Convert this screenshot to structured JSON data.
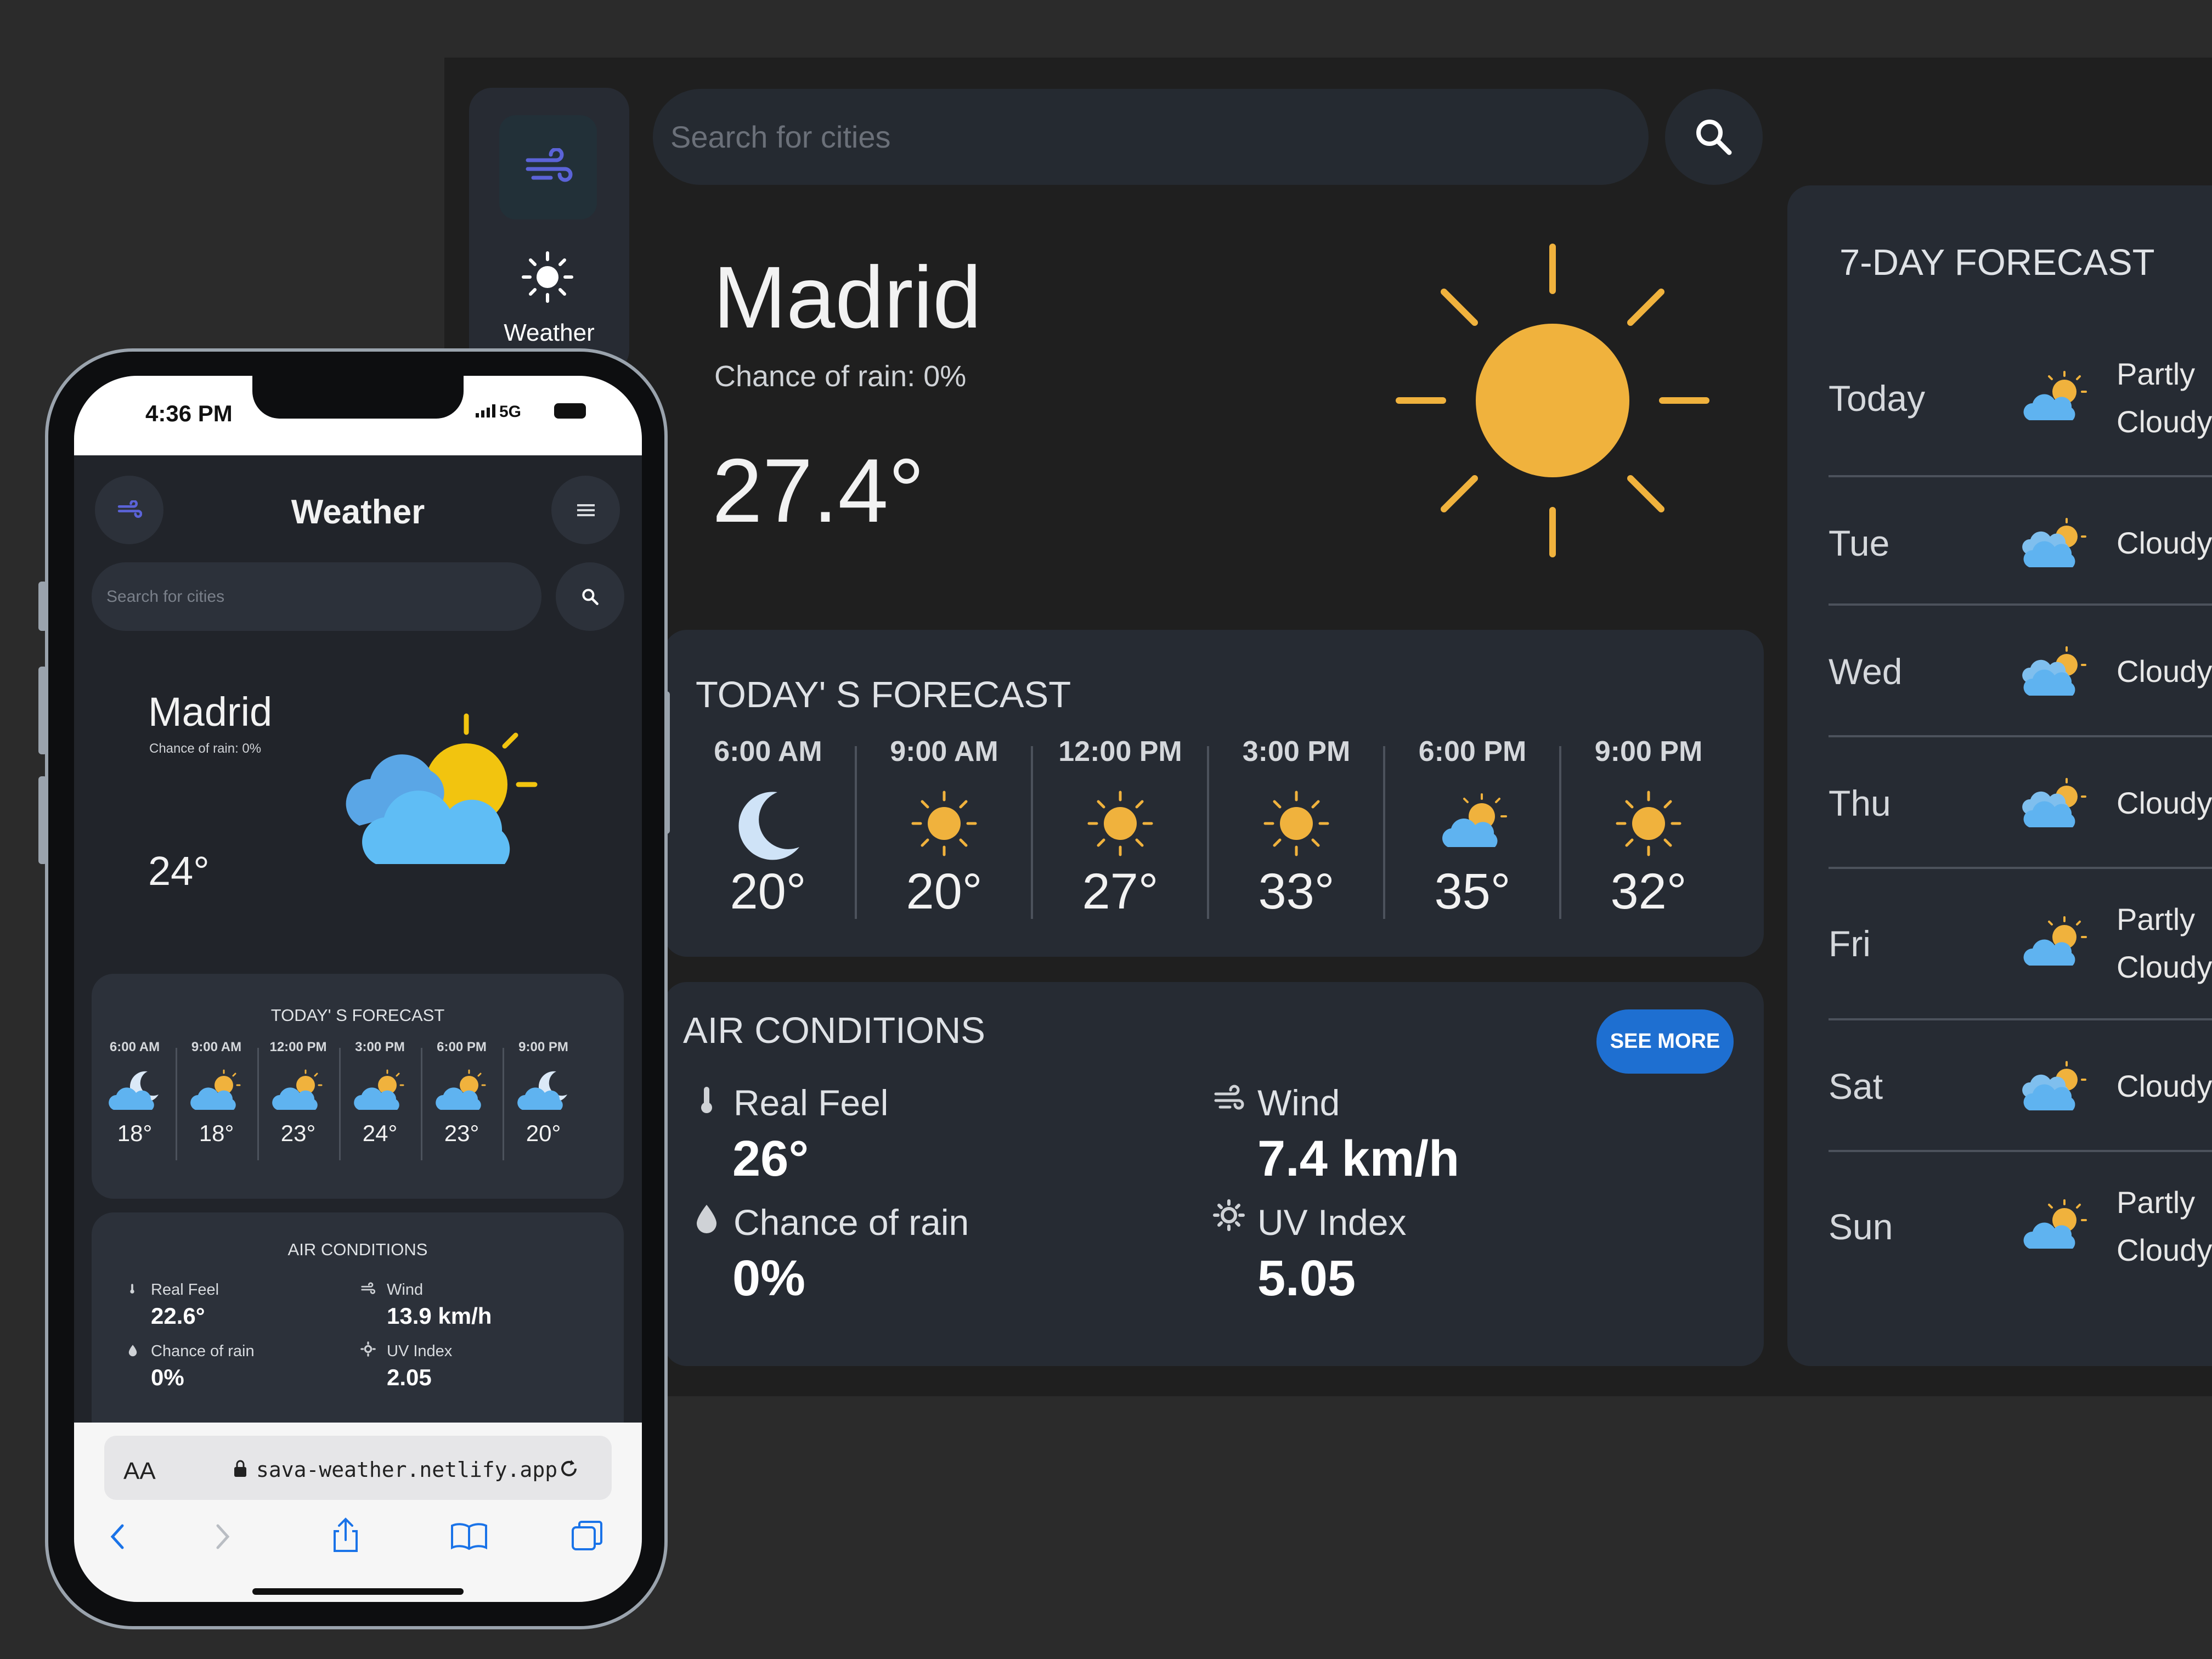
{
  "desktop": {
    "rail": {
      "label": "Weather"
    },
    "search": {
      "placeholder": "Search for cities"
    },
    "current": {
      "city": "Madrid",
      "rain": "Chance of rain: 0%",
      "temp": "27.4°"
    },
    "today": {
      "title": "TODAY' S FORECAST",
      "hours": [
        {
          "time": "6:00 AM",
          "icon": "moon-icon",
          "temp": "20°"
        },
        {
          "time": "9:00 AM",
          "icon": "sun-icon",
          "temp": "20°"
        },
        {
          "time": "12:00 PM",
          "icon": "sun-icon",
          "temp": "27°"
        },
        {
          "time": "3:00 PM",
          "icon": "sun-icon",
          "temp": "33°"
        },
        {
          "time": "6:00 PM",
          "icon": "partly-cloudy-icon",
          "temp": "35°"
        },
        {
          "time": "9:00 PM",
          "icon": "sun-icon",
          "temp": "32°"
        }
      ]
    },
    "air": {
      "title": "AIR CONDITIONS",
      "see_more": "SEE MORE",
      "items": [
        {
          "label": "Real Feel",
          "value": "26°",
          "icon": "thermometer-icon"
        },
        {
          "label": "Wind",
          "value": "7.4 km/h",
          "icon": "wind-icon"
        },
        {
          "label": "Chance of rain",
          "value": "0%",
          "icon": "drop-icon"
        },
        {
          "label": "UV Index",
          "value": "5.05",
          "icon": "uv-icon"
        }
      ]
    },
    "week": {
      "title": "7-DAY FORECAST",
      "days": [
        {
          "day": "Today",
          "cond1": "Partly",
          "cond2": "Cloudy"
        },
        {
          "day": "Tue",
          "cond1": "Cloudy",
          "cond2": ""
        },
        {
          "day": "Wed",
          "cond1": "Cloudy",
          "cond2": ""
        },
        {
          "day": "Thu",
          "cond1": "Cloudy",
          "cond2": ""
        },
        {
          "day": "Fri",
          "cond1": "Partly",
          "cond2": "Cloudy"
        },
        {
          "day": "Sat",
          "cond1": "Cloudy",
          "cond2": ""
        },
        {
          "day": "Sun",
          "cond1": "Partly",
          "cond2": "Cloudy"
        }
      ]
    }
  },
  "phone": {
    "status": {
      "time": "4:36 PM",
      "network": "5G"
    },
    "header": {
      "title": "Weather"
    },
    "search": {
      "placeholder": "Search for cities"
    },
    "current": {
      "city": "Madrid",
      "rain": "Chance of rain: 0%",
      "temp": "24°"
    },
    "today": {
      "title": "TODAY' S FORECAST",
      "hours": [
        {
          "time": "6:00 AM",
          "icon": "cloud-moon-icon",
          "temp": "18°"
        },
        {
          "time": "9:00 AM",
          "icon": "partly-cloudy-icon",
          "temp": "18°"
        },
        {
          "time": "12:00 PM",
          "icon": "partly-cloudy-icon",
          "temp": "23°"
        },
        {
          "time": "3:00 PM",
          "icon": "partly-cloudy-icon",
          "temp": "24°"
        },
        {
          "time": "6:00 PM",
          "icon": "partly-cloudy-icon",
          "temp": "23°"
        },
        {
          "time": "9:00 PM",
          "icon": "cloud-moon-icon",
          "temp": "20°"
        }
      ]
    },
    "air": {
      "title": "AIR CONDITIONS",
      "items": [
        {
          "label": "Real Feel",
          "value": "22.6°"
        },
        {
          "label": "Wind",
          "value": "13.9 km/h"
        },
        {
          "label": "Chance of rain",
          "value": "0%"
        },
        {
          "label": "UV Index",
          "value": "2.05"
        }
      ]
    },
    "browser": {
      "aa": "AA",
      "url": "sava-weather.netlify.app"
    }
  },
  "colors": {
    "sun": "#f0b23d",
    "cloud": "#5fb3f0",
    "accent": "#1e6fd1",
    "card": "#262b33"
  }
}
